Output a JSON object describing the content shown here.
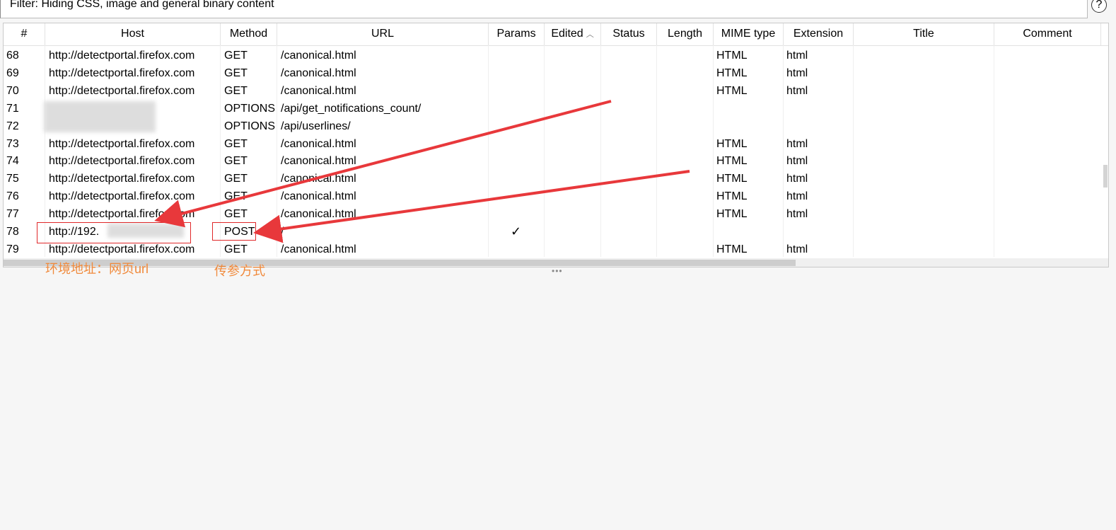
{
  "filter": {
    "text": "Filter: Hiding CSS, image and general binary content",
    "help_icon": "help-icon"
  },
  "columns": [
    "#",
    "Host",
    "Method",
    "URL",
    "Params",
    "Edited",
    "Status",
    "Length",
    "MIME type",
    "Extension",
    "Title",
    "Comment"
  ],
  "sort_column": "Edited",
  "rows": [
    {
      "num": "68",
      "host": "http://detectportal.firefox.com",
      "method": "GET",
      "url": "/canonical.html",
      "params": "",
      "mime": "HTML",
      "ext": "html"
    },
    {
      "num": "69",
      "host": "http://detectportal.firefox.com",
      "method": "GET",
      "url": "/canonical.html",
      "params": "",
      "mime": "HTML",
      "ext": "html"
    },
    {
      "num": "70",
      "host": "http://detectportal.firefox.com",
      "method": "GET",
      "url": "/canonical.html",
      "params": "",
      "mime": "HTML",
      "ext": "html"
    },
    {
      "num": "71",
      "host": "",
      "method": "OPTIONS",
      "url": "/api/get_notifications_count/",
      "params": "",
      "mime": "",
      "ext": ""
    },
    {
      "num": "72",
      "host": "",
      "method": "OPTIONS",
      "url": "/api/userlines/",
      "params": "",
      "mime": "",
      "ext": ""
    },
    {
      "num": "73",
      "host": "http://detectportal.firefox.com",
      "method": "GET",
      "url": "/canonical.html",
      "params": "",
      "mime": "HTML",
      "ext": "html"
    },
    {
      "num": "74",
      "host": "http://detectportal.firefox.com",
      "method": "GET",
      "url": "/canonical.html",
      "params": "",
      "mime": "HTML",
      "ext": "html"
    },
    {
      "num": "75",
      "host": "http://detectportal.firefox.com",
      "method": "GET",
      "url": "/canonical.html",
      "params": "",
      "mime": "HTML",
      "ext": "html"
    },
    {
      "num": "76",
      "host": "http://detectportal.firefox.com",
      "method": "GET",
      "url": "/canonical.html",
      "params": "",
      "mime": "HTML",
      "ext": "html"
    },
    {
      "num": "77",
      "host": "http://detectportal.firefox.com",
      "method": "GET",
      "url": "/canonical.html",
      "params": "",
      "mime": "HTML",
      "ext": "html"
    },
    {
      "num": "78",
      "host": "http://192.",
      "method": "POST",
      "url": "/",
      "params": "✓",
      "mime": "",
      "ext": ""
    },
    {
      "num": "79",
      "host": "http://detectportal.firefox.com",
      "method": "GET",
      "url": "/canonical.html",
      "params": "",
      "mime": "HTML",
      "ext": "html"
    }
  ],
  "annotations": {
    "host_note": "环境地址：网页url",
    "method_note": "传参方式"
  },
  "colors": {
    "annotation_text": "#f08a3c",
    "annotation_box": "#e0282a",
    "arrow": "#e8383b"
  },
  "splitter_icon": "ellipsis-icon"
}
